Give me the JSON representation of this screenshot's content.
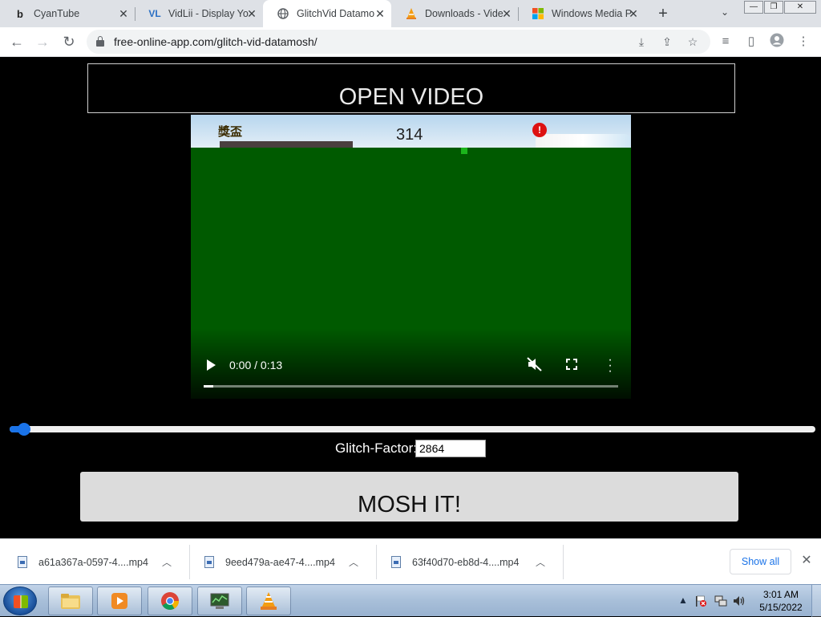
{
  "browser": {
    "tabs": [
      {
        "title": "CyanTube",
        "favicon": "b"
      },
      {
        "title": "VidLii - Display Yo",
        "favicon": "VL"
      },
      {
        "title": "GlitchVid Datamo",
        "favicon": "globe"
      },
      {
        "title": "Downloads - Vide",
        "favicon": "cone"
      },
      {
        "title": "Windows Media P",
        "favicon": "windows"
      }
    ],
    "active_tab_index": 2,
    "url": "free-online-app.com/glitch-vid-datamosh/"
  },
  "page": {
    "open_button_label": "OPEN VIDEO",
    "video": {
      "time_display": "0:00 / 0:13",
      "overlay_cjk_text": "獎盃",
      "overlay_number_text": "314",
      "alert_symbol": "!"
    },
    "glitch_factor": {
      "label": "Glitch-Factor:",
      "value": "2864",
      "slider_fraction": 0.01
    },
    "mosh_button_label": "MOSH IT!"
  },
  "downloads": {
    "items": [
      {
        "name": "a61a367a-0597-4....mp4"
      },
      {
        "name": "9eed479a-ae47-4....mp4"
      },
      {
        "name": "63f40d70-eb8d-4....mp4"
      }
    ],
    "show_all_label": "Show all"
  },
  "taskbar": {
    "time": "3:01 AM",
    "date": "5/15/2022"
  },
  "colors": {
    "accent": "#1a73e8",
    "video_green": "#005a00",
    "page_bg": "#000000"
  }
}
